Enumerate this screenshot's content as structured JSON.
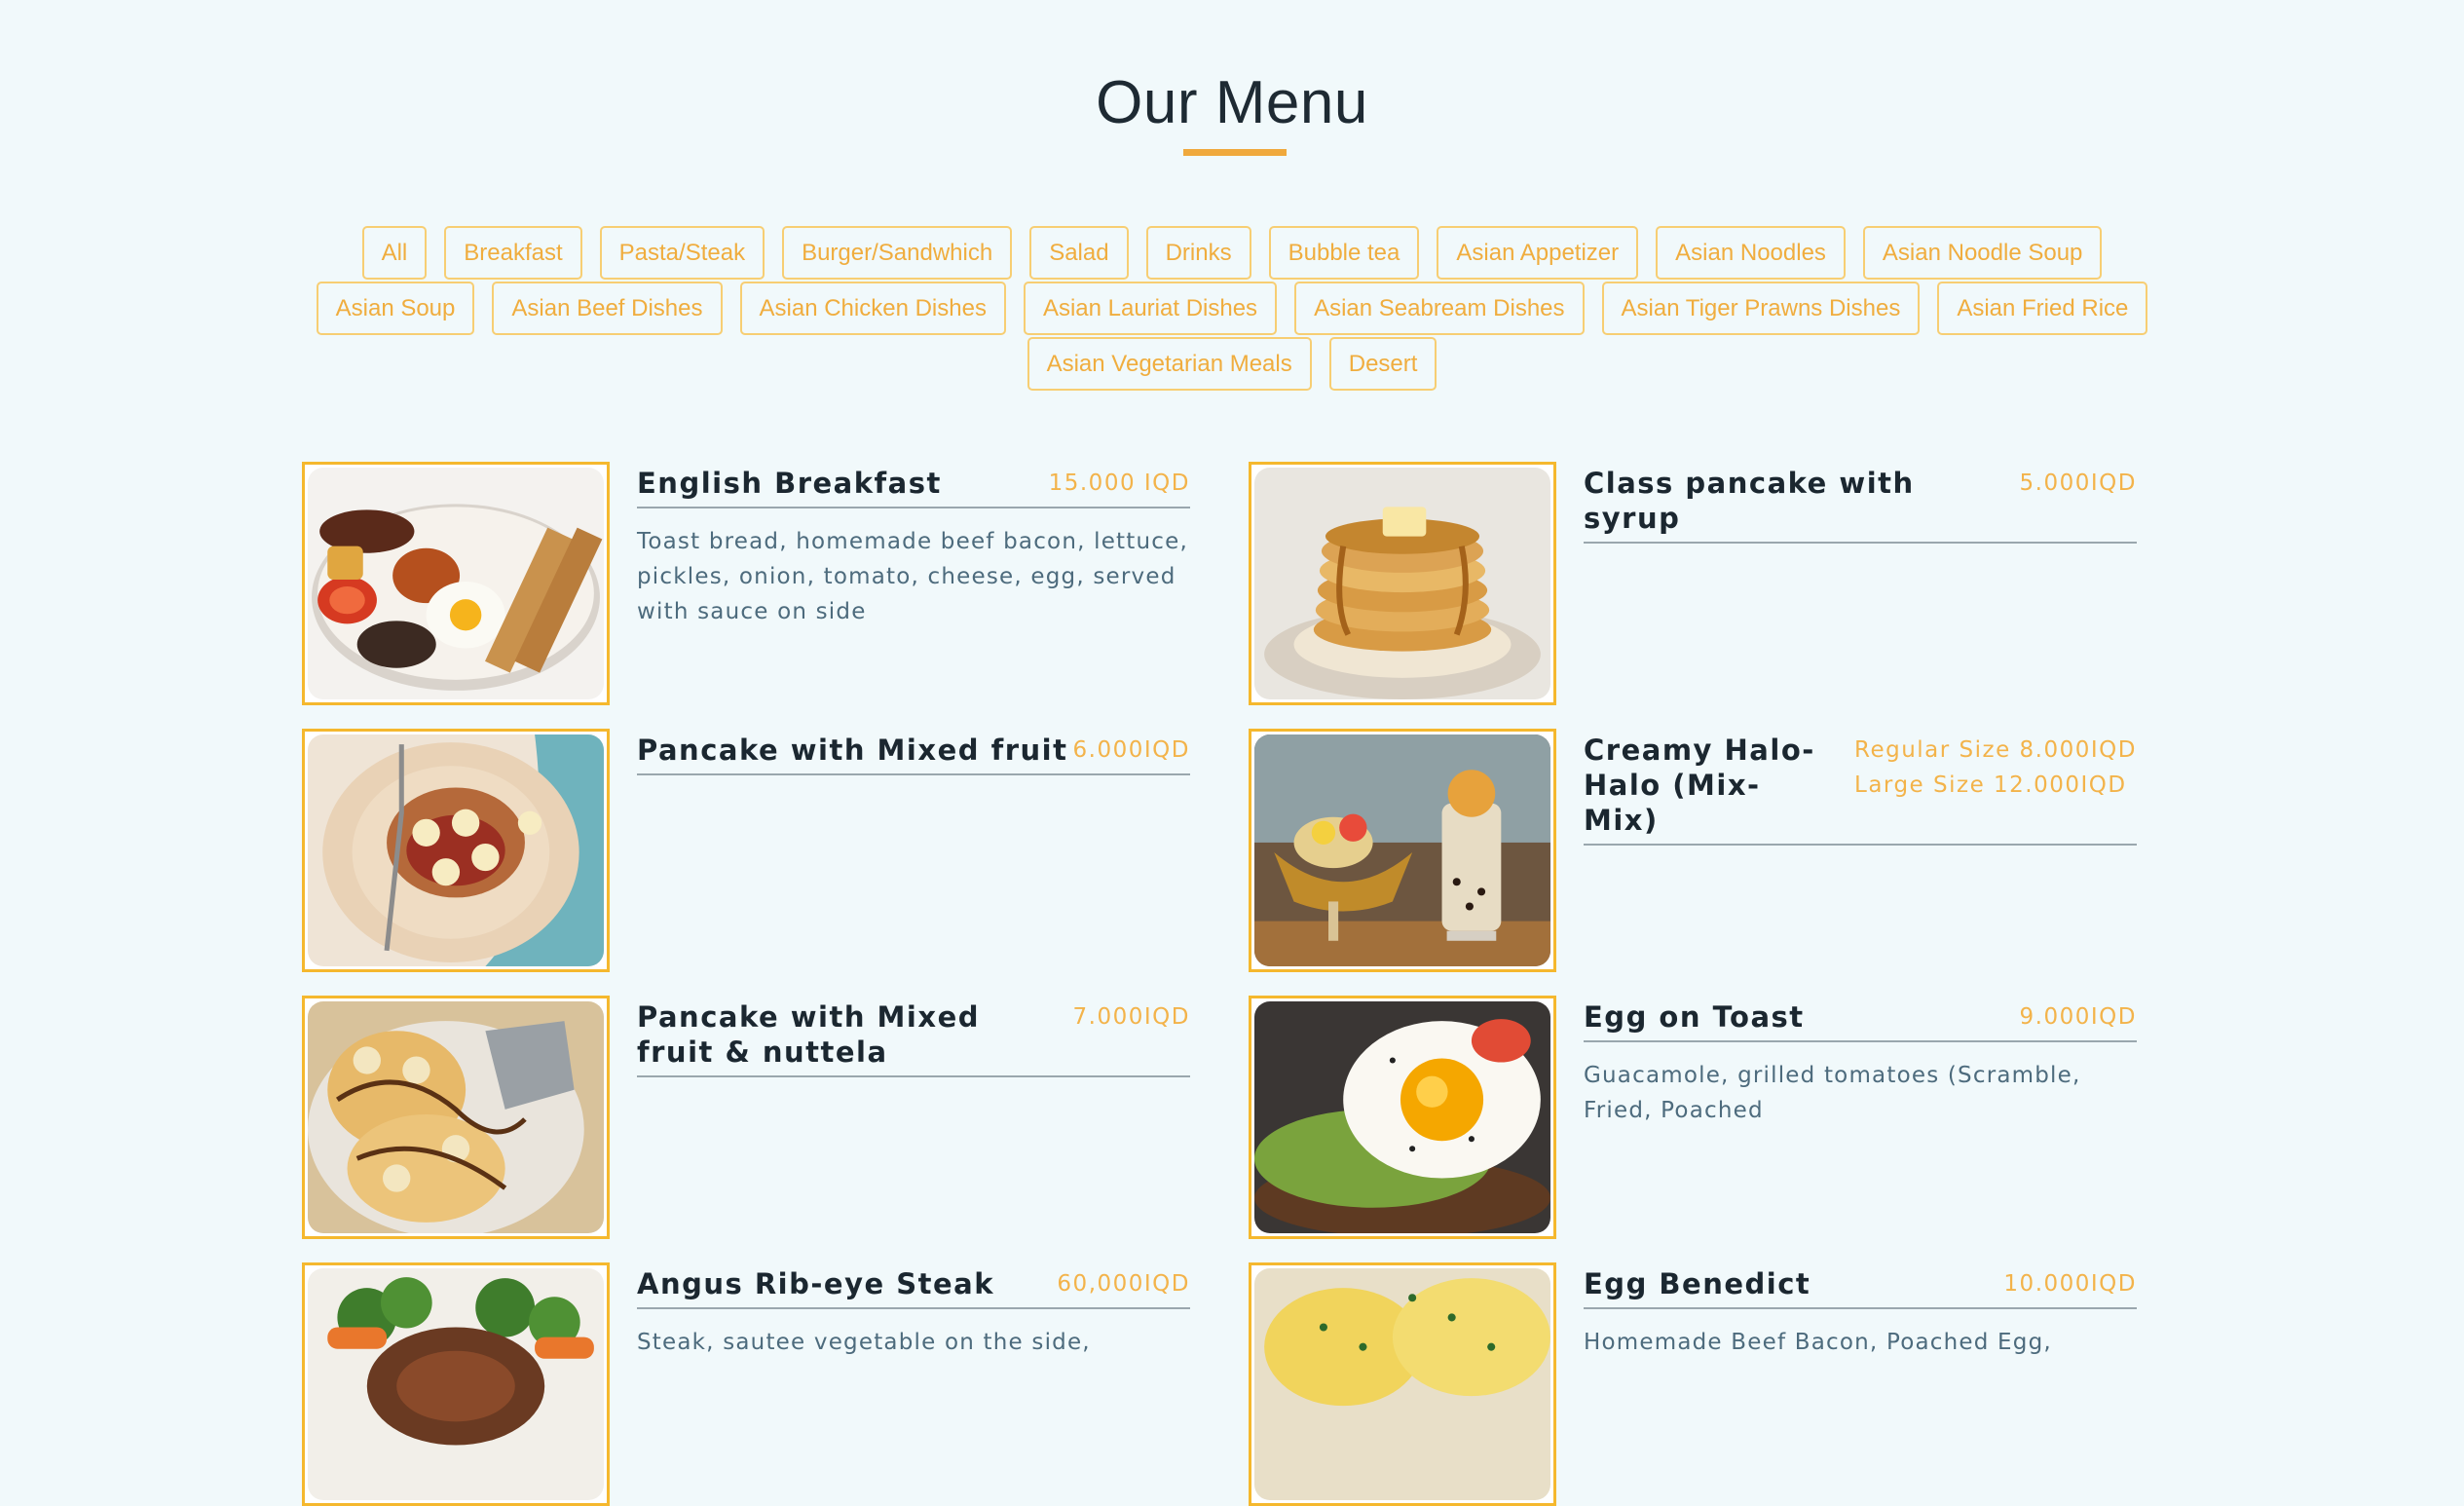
{
  "page": {
    "title": "Our Menu",
    "accent_color": "#f0a93c",
    "background_color": "#f1f9fb"
  },
  "filters": [
    "All",
    "Breakfast",
    "Pasta/Steak",
    "Burger/Sandwhich",
    "Salad",
    "Drinks",
    "Bubble tea",
    "Asian Appetizer",
    "Asian Noodles",
    "Asian Noodle Soup",
    "Asian Soup",
    "Asian Beef Dishes",
    "Asian Chicken Dishes",
    "Asian Lauriat Dishes",
    "Asian Seabream Dishes",
    "Asian Tiger Prawns Dishes",
    "Asian Fried Rice",
    "Asian Vegetarian Meals",
    "Desert"
  ],
  "menu_items": [
    {
      "name": "English Breakfast",
      "price": "15.000 IQD",
      "description": "Toast bread, homemade beef bacon, lettuce, pickles, onion, tomato, cheese, egg, served with sauce on side",
      "image_icon": "english-breakfast-photo"
    },
    {
      "name": "Class pancake with syrup",
      "price": "5.000IQD",
      "description": "",
      "image_icon": "pancake-syrup-photo"
    },
    {
      "name": "Pancake with Mixed fruit",
      "price": "6.000IQD",
      "description": "",
      "image_icon": "pancake-fruit-photo"
    },
    {
      "name": "Creamy Halo-Halo (Mix-Mix)",
      "price_regular": "Regular Size 8.000IQD",
      "price_large": "Large Size 12.000IQD",
      "description": "",
      "image_icon": "halo-halo-photo"
    },
    {
      "name": "Pancake with Mixed fruit & nuttela",
      "price": "7.000IQD",
      "description": "",
      "image_icon": "pancake-nutella-photo"
    },
    {
      "name": "Egg on Toast",
      "price": "9.000IQD",
      "description": "Guacamole, grilled tomatoes (Scramble, Fried, Poached",
      "image_icon": "egg-toast-photo"
    },
    {
      "name": "Angus Rib-eye Steak",
      "price": "60,000IQD",
      "description": "Steak, sautee vegetable on the side,",
      "image_icon": "steak-photo"
    },
    {
      "name": "Egg Benedict",
      "price": "10.000IQD",
      "description": "Homemade Beef Bacon, Poached Egg,",
      "image_icon": "egg-benedict-photo"
    }
  ]
}
